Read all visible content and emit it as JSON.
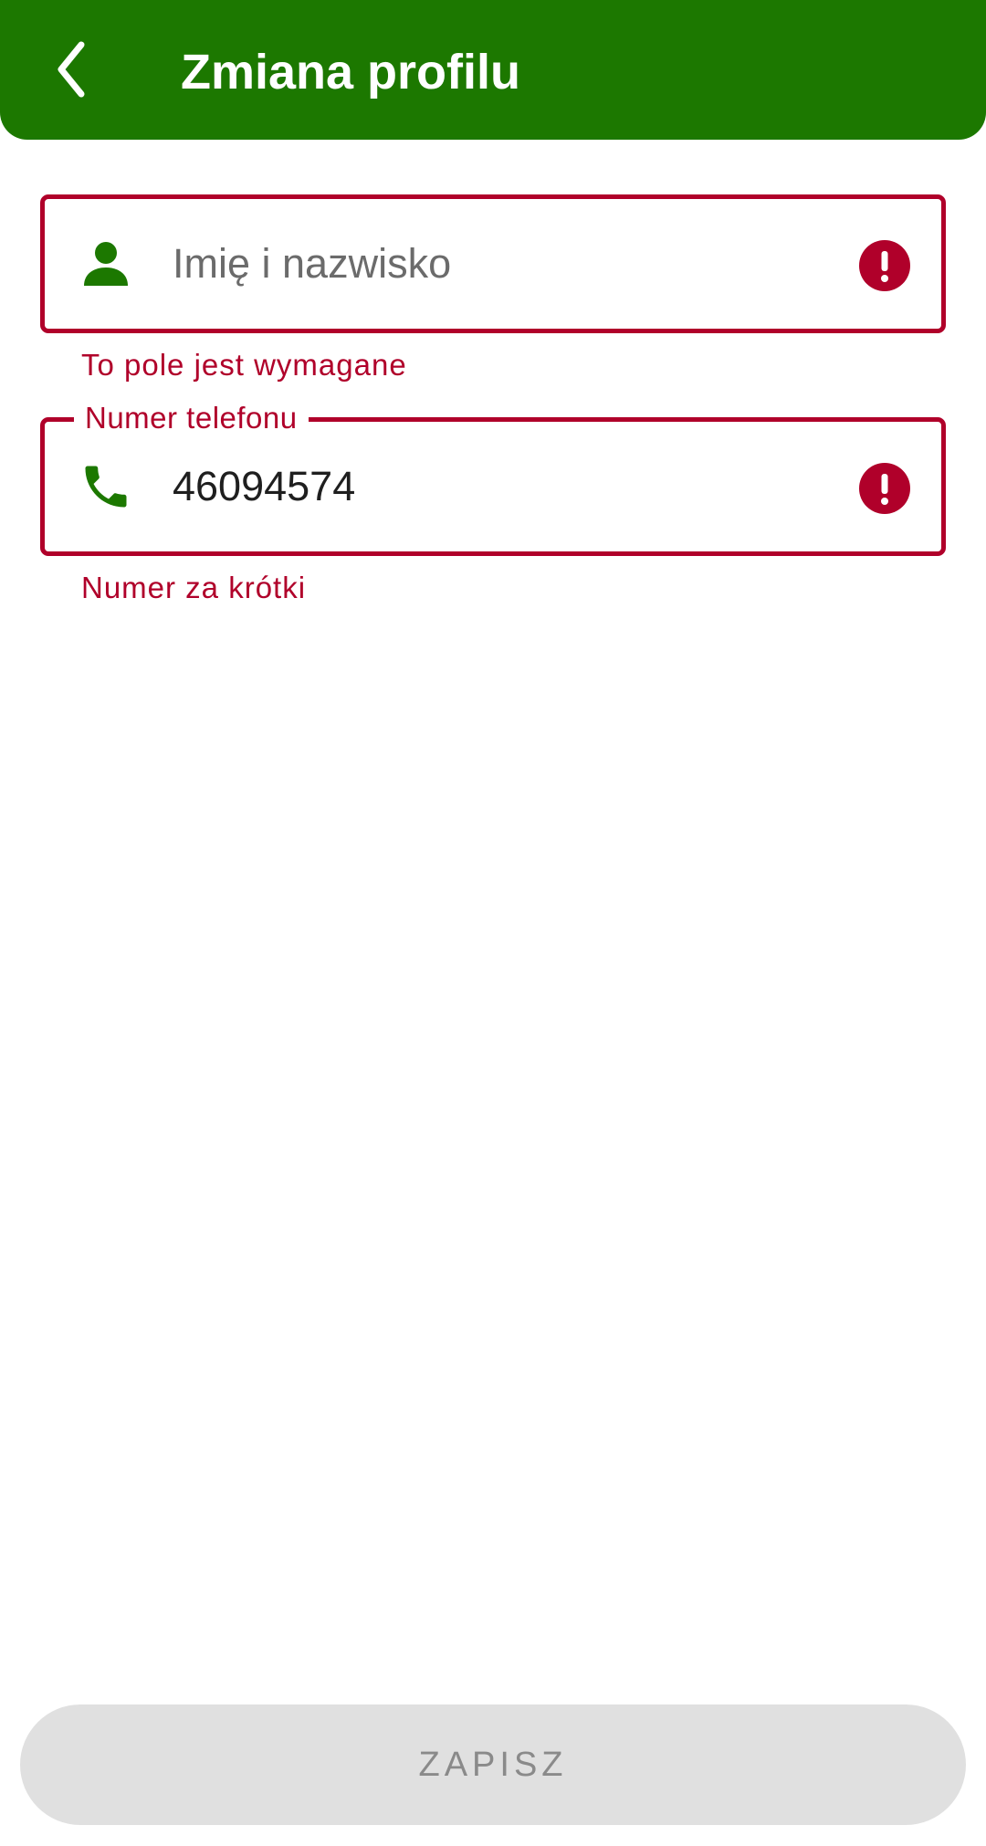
{
  "app_bar": {
    "title": "Zmiana profilu",
    "background_color": "#1c7800",
    "back_icon": "chevron-left-icon"
  },
  "form": {
    "name_field": {
      "placeholder": "Imię i nazwisko",
      "value": "",
      "icon": "person-icon",
      "error_icon": "exclamation-circle-icon",
      "error_text": "To pole jest wymagane"
    },
    "phone_field": {
      "label": "Numer telefonu",
      "value": "46094574",
      "icon": "phone-icon",
      "error_icon": "exclamation-circle-icon",
      "error_text": "Numer za krótki"
    },
    "error_color": "#b0002a",
    "icon_color": "#1c7800"
  },
  "save_button": {
    "label": "ZAPISZ",
    "state": "disabled"
  }
}
